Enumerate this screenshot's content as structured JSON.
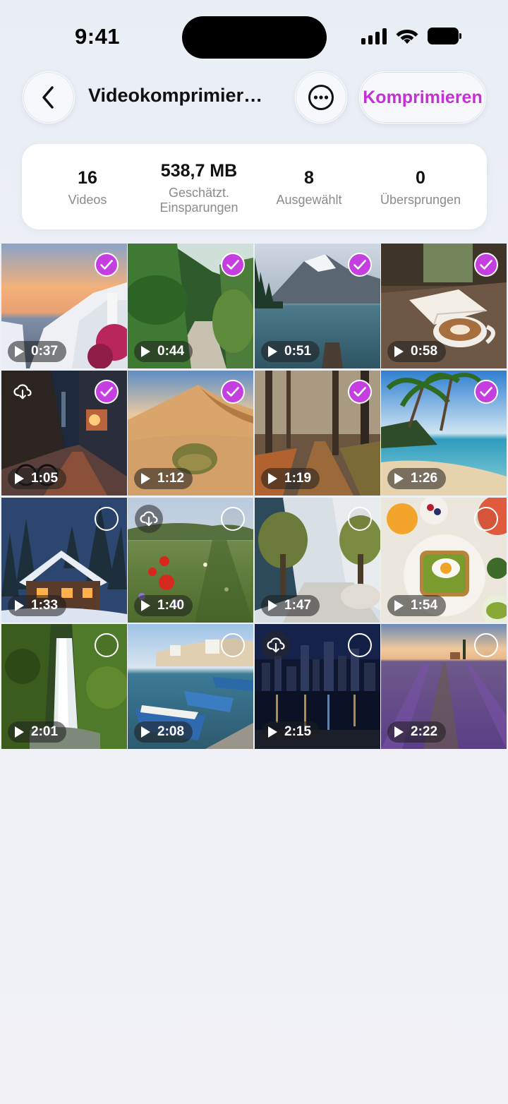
{
  "status": {
    "time": "9:41"
  },
  "nav": {
    "title": "Videokomprimier…",
    "action_label": "Komprimieren"
  },
  "stats": [
    {
      "value": "16",
      "label": "Videos"
    },
    {
      "value": "538,7 MB",
      "label": "Geschätzt. Einsparungen"
    },
    {
      "value": "8",
      "label": "Ausgewählt"
    },
    {
      "value": "0",
      "label": "Übersprungen"
    }
  ],
  "colors": {
    "accent": "#c42fd6",
    "check": "#c53ee0"
  },
  "videos": [
    {
      "duration": "0:37",
      "selected": true,
      "cloud": false,
      "scene": "santorini-sunset"
    },
    {
      "duration": "0:44",
      "selected": true,
      "cloud": false,
      "scene": "greenhouse-path"
    },
    {
      "duration": "0:51",
      "selected": true,
      "cloud": false,
      "scene": "mountain-lake"
    },
    {
      "duration": "0:58",
      "selected": true,
      "cloud": false,
      "scene": "book-and-coffee"
    },
    {
      "duration": "1:05",
      "selected": true,
      "cloud": true,
      "scene": "rainy-night-street"
    },
    {
      "duration": "1:12",
      "selected": true,
      "cloud": false,
      "scene": "desert-dunes"
    },
    {
      "duration": "1:19",
      "selected": true,
      "cloud": false,
      "scene": "autumn-forest-path"
    },
    {
      "duration": "1:26",
      "selected": true,
      "cloud": false,
      "scene": "tropical-beach"
    },
    {
      "duration": "1:33",
      "selected": false,
      "cloud": false,
      "scene": "snowy-cabin"
    },
    {
      "duration": "1:40",
      "selected": false,
      "cloud": true,
      "scene": "poppy-meadow"
    },
    {
      "duration": "1:47",
      "selected": false,
      "cloud": false,
      "scene": "atrium-olive-trees"
    },
    {
      "duration": "1:54",
      "selected": false,
      "cloud": false,
      "scene": "avocado-toast-breakfast"
    },
    {
      "duration": "2:01",
      "selected": false,
      "cloud": false,
      "scene": "forest-waterfall"
    },
    {
      "duration": "2:08",
      "selected": false,
      "cloud": false,
      "scene": "harbor-boats"
    },
    {
      "duration": "2:15",
      "selected": false,
      "cloud": true,
      "scene": "city-skyline-night"
    },
    {
      "duration": "2:22",
      "selected": false,
      "cloud": false,
      "scene": "lavender-field"
    }
  ]
}
